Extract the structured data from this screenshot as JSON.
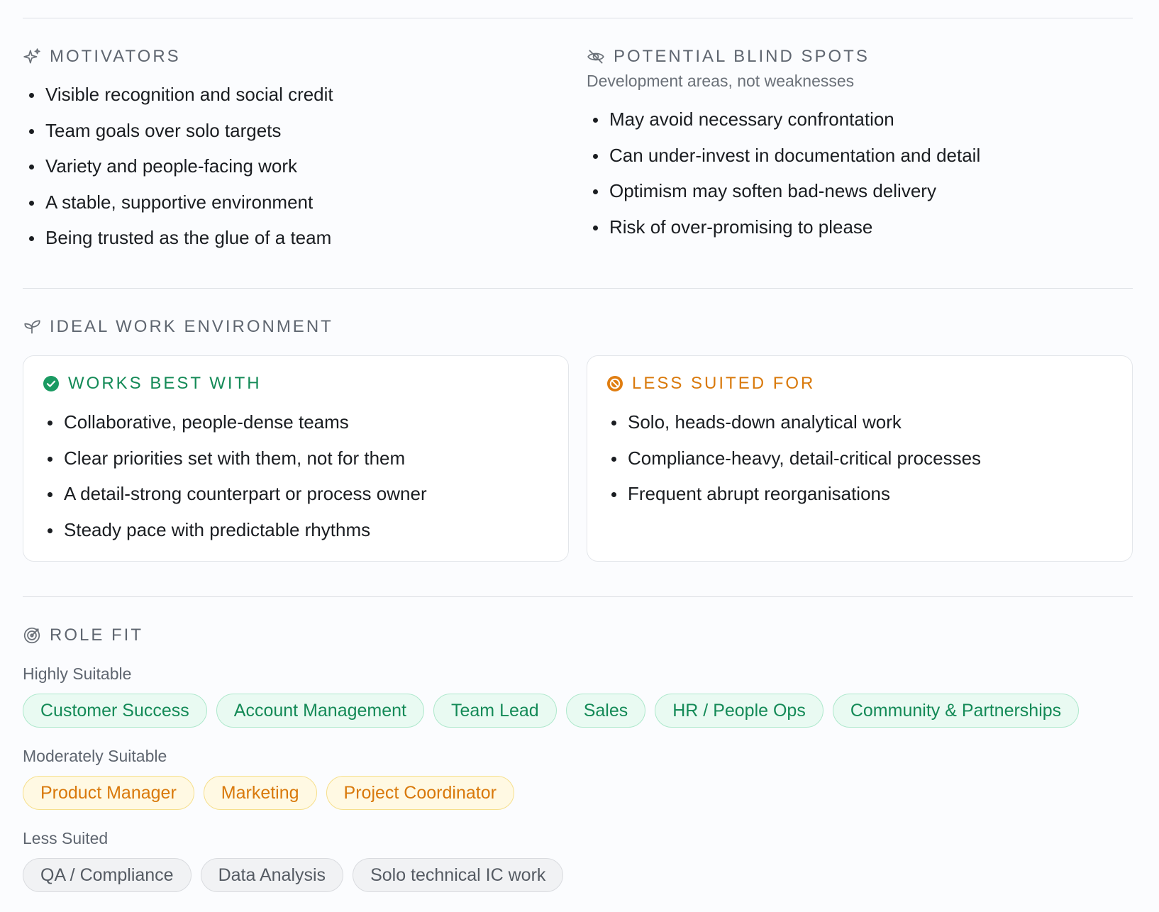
{
  "motivators": {
    "title": "MOTIVATORS",
    "items": [
      "Visible recognition and social credit",
      "Team goals over solo targets",
      "Variety and people-facing work",
      "A stable, supportive environment",
      "Being trusted as the glue of a team"
    ]
  },
  "blind_spots": {
    "title": "POTENTIAL BLIND SPOTS",
    "subtitle": "Development areas, not weaknesses",
    "items": [
      "May avoid necessary confrontation",
      "Can under-invest in documentation and detail",
      "Optimism may soften bad-news delivery",
      "Risk of over-promising to please"
    ]
  },
  "environment": {
    "title": "IDEAL WORK ENVIRONMENT",
    "works_best": {
      "title": "WORKS BEST WITH",
      "color": "#148a57",
      "items": [
        "Collaborative, people-dense teams",
        "Clear priorities set with them, not for them",
        "A detail-strong counterpart or process owner",
        "Steady pace with predictable rhythms"
      ]
    },
    "less_suited": {
      "title": "LESS SUITED FOR",
      "color": "#d9790b",
      "items": [
        "Solo, heads-down analytical work",
        "Compliance-heavy, detail-critical processes",
        "Frequent abrupt reorganisations"
      ]
    }
  },
  "role_fit": {
    "title": "ROLE FIT",
    "highly_label": "Highly Suitable",
    "highly": [
      "Customer Success",
      "Account Management",
      "Team Lead",
      "Sales",
      "HR / People Ops",
      "Community & Partnerships"
    ],
    "moderately_label": "Moderately Suitable",
    "moderately": [
      "Product Manager",
      "Marketing",
      "Project Coordinator"
    ],
    "less_label": "Less Suited",
    "less": [
      "QA / Compliance",
      "Data Analysis",
      "Solo technical IC work"
    ]
  }
}
